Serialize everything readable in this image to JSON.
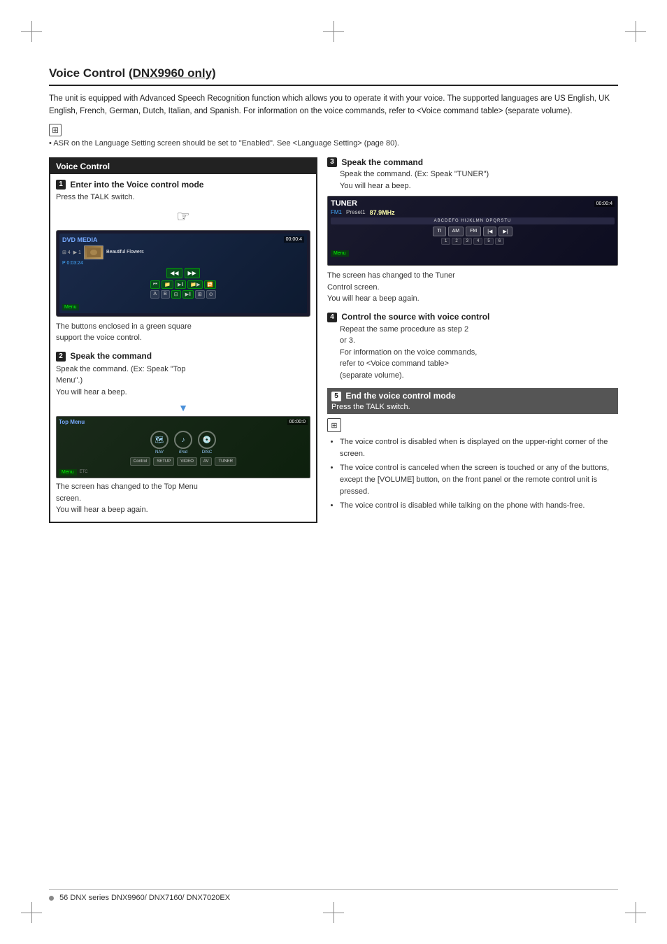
{
  "page": {
    "title": "Voice Control (DNX9960 only)",
    "title_plain": "Voice Control ",
    "title_underline": "(DNX9960 only)",
    "intro": "The unit is equipped with Advanced Speech Recognition function which allows you to operate it with your voice. The supported languages are US English, UK English, French, German, Dutch, Italian, and Spanish. For information on the voice commands, refer to <Voice command table> (separate volume).",
    "note_text": "ASR on the Language Setting screen should be set to \"Enabled\". See <Language Setting> (page 80).",
    "footer_page": "56",
    "footer_series": "DNX series  DNX9960/ DNX7160/ DNX7020EX"
  },
  "left_col": {
    "box_title": "Voice Control",
    "step1_title": "Enter into the Voice control mode",
    "step1_desc": "Press the TALK switch.",
    "step1_screen_caption1": "The buttons enclosed in a green square",
    "step1_screen_caption2": "support the voice control.",
    "step2_title": "Speak the command",
    "step2_desc1": "Speak the command. (Ex: Speak \"Top",
    "step2_desc2": "Menu\".)",
    "step2_desc3": "You will hear a beep.",
    "step2_screen_caption1": "The screen has changed to the Top Menu",
    "step2_screen_caption2": "screen.",
    "step2_screen_caption3": "You will hear a beep again."
  },
  "right_col": {
    "step3_title": "Speak the command",
    "step3_desc1": "Speak the command. (Ex: Speak \"TUNER\")",
    "step3_desc2": "You will hear a beep.",
    "tuner_label": "TUNER",
    "tuner_fm": "FM1",
    "tuner_preset": "Preset1",
    "tuner_freq": "87.9MHz",
    "tuner_keys": "ABCDEFG HIJKLMN OPQRSTU",
    "tuner_caption1": "The screen has changed to the Tuner",
    "tuner_caption2": "Control screen.",
    "tuner_caption3": "You will hear a beep again.",
    "step4_title": "Control the source with voice control",
    "step4_desc1": "Repeat the same procedure as step 2",
    "step4_desc2": "or 3.",
    "step4_desc3": "For information on the voice commands,",
    "step4_desc4": "refer to <Voice command table>",
    "step4_desc5": "(separate volume).",
    "step5_title": "End the voice control mode",
    "step5_desc": "Press the TALK switch.",
    "note1": "The voice control is disabled when  is displayed on the upper-right corner of the screen.",
    "note2": "The voice control is canceled when the screen is touched or any of the buttons, except the [VOLUME] button, on the front panel or the remote control unit is pressed.",
    "note3": "The voice control is disabled while talking on the phone with hands-free."
  },
  "dvd_screen": {
    "label": "DVD MEDIA",
    "time": "00:00:4",
    "track_num": "4",
    "track_pos": "1",
    "progress": "P  0:03:24",
    "song_title": "Beautiful Flowers",
    "menu": "Menu"
  },
  "top_menu_screen": {
    "title": "Top Menu",
    "time": "00:00:0",
    "nav_label": "NAV",
    "ipod_label": "iPod",
    "disc_label": "DISC",
    "menu": "Menu"
  }
}
